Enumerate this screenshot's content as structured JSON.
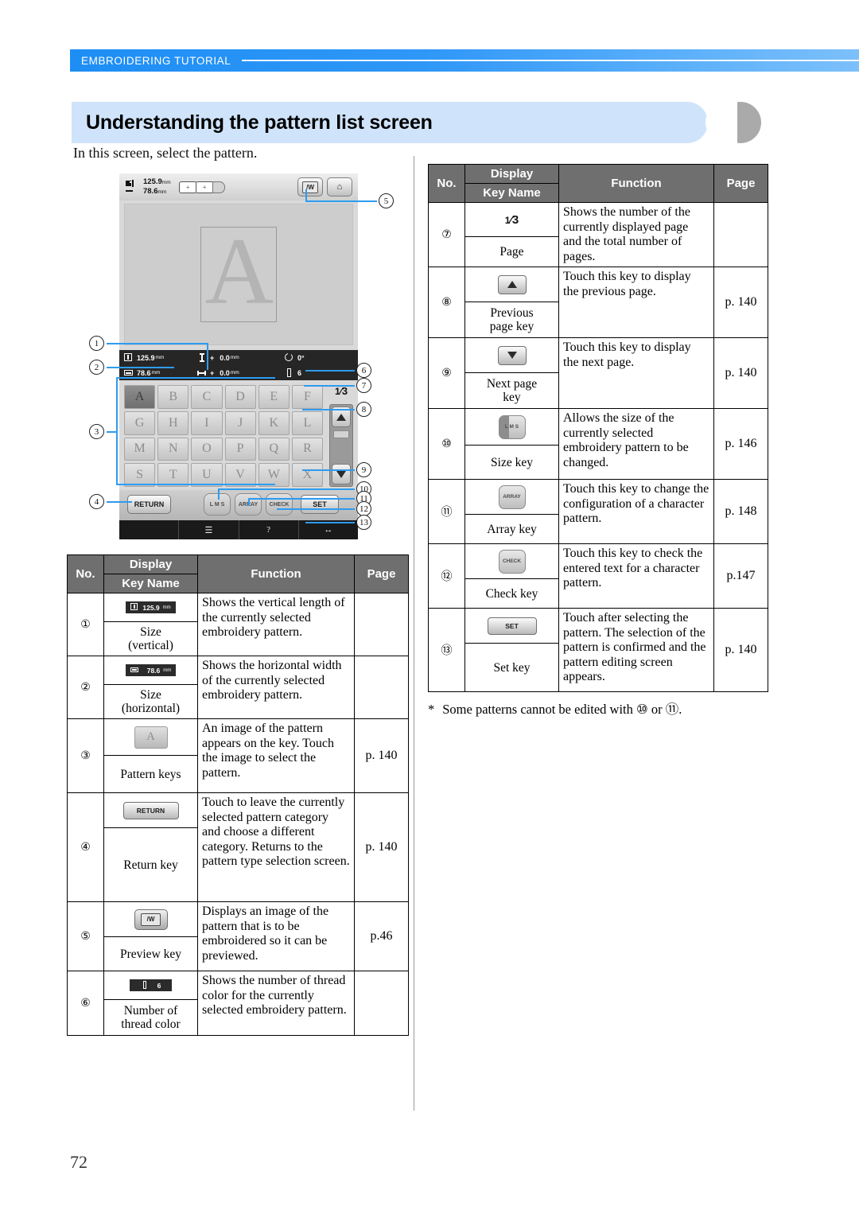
{
  "header": {
    "section_label": "EMBROIDERING TUTORIAL",
    "title": "Understanding the pattern list screen",
    "intro": "In this screen, select the pattern."
  },
  "machine_screen": {
    "size_vertical": "125.9",
    "size_horizontal": "78.6",
    "unit": "mm",
    "top_keys": [
      "preview-key",
      "home-key"
    ],
    "info_bar": {
      "vertical_value": "125.9",
      "horizontal_value": "78.6",
      "offset_vertical": "0.0",
      "offset_horizontal": "0.0",
      "offset_sign": "+",
      "rotation": "0",
      "rotation_unit": "°",
      "thread_colors": "6",
      "unit": "mm"
    },
    "pattern_keys": [
      "A",
      "B",
      "C",
      "D",
      "E",
      "F",
      "G",
      "H",
      "I",
      "J",
      "K",
      "L",
      "M",
      "N",
      "O",
      "P",
      "Q",
      "R",
      "S",
      "T",
      "U",
      "V",
      "W",
      "X"
    ],
    "selected_pattern": "A",
    "page_current": "1",
    "page_total": "3",
    "buttons": {
      "return": "RETURN",
      "size": "L M S",
      "array": "ARRAY",
      "check": "CHECK",
      "set": "SET"
    },
    "callouts": [
      "1",
      "2",
      "3",
      "4",
      "5",
      "6",
      "7",
      "8",
      "9",
      "10",
      "11",
      "12",
      "13"
    ]
  },
  "table_headers": {
    "no": "No.",
    "display": "Display",
    "key_name": "Key Name",
    "function": "Function",
    "page": "Page"
  },
  "table_left": [
    {
      "no": "①",
      "display_kind": "chip-vertical",
      "display_text": "125.9",
      "display_unit": "mm",
      "key_name": "Size\n(vertical)",
      "function": "Shows the vertical length of the currently selected embroidery pattern.",
      "page": ""
    },
    {
      "no": "②",
      "display_kind": "chip-horizontal",
      "display_text": "78.6",
      "display_unit": "mm",
      "key_name": "Size\n(horizontal)",
      "function": "Shows the horizontal width of the currently selected embroidery pattern.",
      "page": ""
    },
    {
      "no": "③",
      "display_kind": "pattern-key",
      "display_text": "A",
      "key_name": "Pattern keys",
      "function": "An image of the pattern appears on the key. Touch the image to select the pattern.",
      "page": "p. 140"
    },
    {
      "no": "④",
      "display_kind": "return-button",
      "display_text": "RETURN",
      "key_name": "Return key",
      "function": "Touch to leave the currently selected pattern category and choose a different category. Returns to the pattern type selection screen.",
      "page": "p. 140"
    },
    {
      "no": "⑤",
      "display_kind": "preview-button",
      "display_text": "",
      "key_name": "Preview key",
      "function": "Displays an image of the pattern that is to be embroidered so it can be previewed.",
      "page": "p.46"
    },
    {
      "no": "⑥",
      "display_kind": "chip-thread",
      "display_text": "6",
      "key_name": "Number of\nthread color",
      "function": "Shows the number of thread color for the currently selected embroidery pattern.",
      "page": ""
    }
  ],
  "table_right": [
    {
      "no": "⑦",
      "display_kind": "fraction",
      "display_text": "1/3",
      "fraction_num": "1",
      "fraction_den": "3",
      "key_name": "Page",
      "function": "Shows the number of the currently displayed page and the total number of pages.",
      "page": ""
    },
    {
      "no": "⑧",
      "display_kind": "arrow-up",
      "display_text": "",
      "key_name": "Previous\npage key",
      "function": "Touch this key to display the previous page.",
      "page": "p. 140"
    },
    {
      "no": "⑨",
      "display_kind": "arrow-down",
      "display_text": "",
      "key_name": "Next page\nkey",
      "function": "Touch this key to display the next page.",
      "page": "p. 140"
    },
    {
      "no": "⑩",
      "display_kind": "lms-key",
      "display_text": "L M S",
      "key_name": "Size key",
      "function": "Allows the size of the currently selected embroidery pattern to be changed.",
      "page": "p. 146"
    },
    {
      "no": "⑪",
      "display_kind": "round-key",
      "display_text": "ARRAY",
      "key_name": "Array key",
      "function": "Touch this key to change the configuration of a character pattern.",
      "page": "p. 148"
    },
    {
      "no": "⑫",
      "display_kind": "round-key",
      "display_text": "CHECK",
      "key_name": "Check key",
      "function": "Touch this key to check the entered text for a character pattern.",
      "page": "p.147"
    },
    {
      "no": "⑬",
      "display_kind": "set-button",
      "display_text": "SET",
      "key_name": "Set key",
      "function": "Touch after selecting the pattern. The selection of the pattern is confirmed and the pattern editing screen appears.",
      "page": "p. 140"
    }
  ],
  "footnote": {
    "marker": "*",
    "text": "Some patterns cannot be edited with ⑩ or ⑪."
  },
  "page_number": "72",
  "colors": {
    "ribbon_blue": "#1e8ef5",
    "title_blue": "#cfe4fb",
    "title_gray": "#aaaaaa",
    "table_header_gray": "#6f6f6f",
    "callout_leader": "#2e9bf0"
  }
}
